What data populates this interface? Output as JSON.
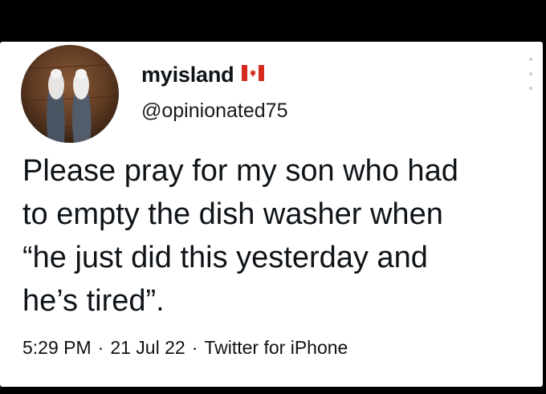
{
  "tweet": {
    "author": {
      "display_name": "myisland",
      "handle": "@opinionated75",
      "flag_icon": "canada-flag-icon",
      "avatar_icon": "profile-photo-feet"
    },
    "text": "Please pray for my son who had\nto empty the dish washer when\n“he just did this yesterday and\nhe’s tired”.",
    "meta": {
      "time": "5:29 PM",
      "date": "21 Jul 22",
      "source": "Twitter for iPhone",
      "separator": "·"
    },
    "more_icon": "more-options-vertical-icon"
  },
  "colors": {
    "background": "#000000",
    "card": "#ffffff",
    "text": "#0f1419",
    "flag_red": "#d52b1e"
  }
}
